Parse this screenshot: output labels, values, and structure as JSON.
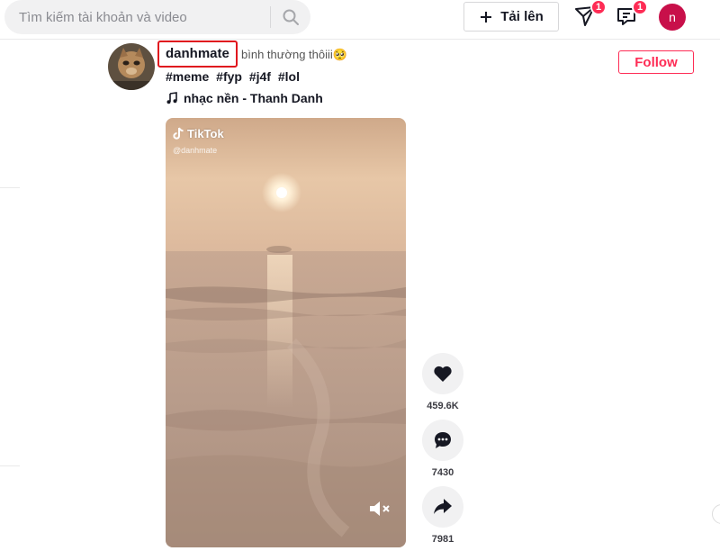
{
  "header": {
    "search_placeholder": "Tìm kiếm tài khoản và video",
    "upload_label": "Tải lên",
    "inbox_badge": "1",
    "messages_badge": "1",
    "profile_initial": "n"
  },
  "post": {
    "username": "danhmate",
    "caption": "bình thường thôiii🥺",
    "hashtags": [
      "#meme",
      "#fyp",
      "#j4f",
      "#lol"
    ],
    "music": "nhạc nền - Thanh Danh",
    "follow_label": "Follow",
    "video": {
      "watermark_brand": "TikTok",
      "watermark_handle": "@danhmate"
    },
    "actions": {
      "likes": "459.6K",
      "comments": "7430",
      "shares": "7981"
    }
  },
  "colors": {
    "accent": "#fe2c55",
    "highlight_box": "#e0141e",
    "profile_avatar": "#c8104a"
  }
}
